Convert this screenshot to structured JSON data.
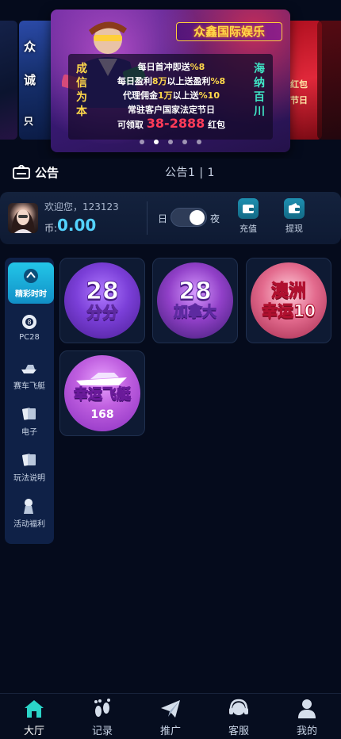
{
  "banner": {
    "brand": "众鑫国际娱乐",
    "left_side": "成信为本",
    "right_side": "海纳百川",
    "line1_pre": "每日首冲即送",
    "line1_hl": "%8",
    "line2_pre": "每日盈利",
    "line2_hl1": "8万",
    "line2_mid": "以上送盈利",
    "line2_hl2": "%8",
    "line3_pre": "代理佣金",
    "line3_hl1": "1万",
    "line3_mid": "以上送",
    "line3_hl2": "%10",
    "line4": "常驻客户国家法定节日",
    "line5_pre": "可领取",
    "line5_hl": "38-2888",
    "line5_post": "红包",
    "left_card_text1": "众",
    "left_card_text2": "诚",
    "left_card_text3": "只",
    "right_card_text1": "红包",
    "right_card_text2": "节日",
    "dots_count": 5,
    "active_dot": 1
  },
  "notice": {
    "title": "公告",
    "text": "公告1 | 1"
  },
  "user": {
    "welcome": "欢迎您，123123",
    "coin_label": "币:",
    "balance": "0.00",
    "day_label": "日",
    "night_label": "夜",
    "theme_mode": "night",
    "recharge_label": "充值",
    "withdraw_label": "提现"
  },
  "sidebar": {
    "items": [
      {
        "label": "精彩时时",
        "icon": "lottery-icon",
        "active": true
      },
      {
        "label": "PC28",
        "icon": "eight-ball-icon"
      },
      {
        "label": "赛车飞艇",
        "icon": "speedboat-icon"
      },
      {
        "label": "电子",
        "icon": "cards-icon"
      },
      {
        "label": "玩法说明",
        "icon": "cards-icon"
      },
      {
        "label": "活动福利",
        "icon": "gift-icon"
      }
    ]
  },
  "games": [
    {
      "main": "28",
      "sub": "分分"
    },
    {
      "main": "28",
      "sub": "加拿大"
    },
    {
      "main": "澳洲",
      "sub": "幸运10"
    },
    {
      "main": "幸运飞艇",
      "sub": "168"
    }
  ],
  "nav": {
    "items": [
      {
        "label": "大厅",
        "icon": "home-icon",
        "active": true
      },
      {
        "label": "记录",
        "icon": "footprints-icon"
      },
      {
        "label": "推广",
        "icon": "paper-plane-icon"
      },
      {
        "label": "客服",
        "icon": "headset-icon"
      },
      {
        "label": "我的",
        "icon": "user-icon"
      }
    ]
  },
  "colors": {
    "background": "#050b1c",
    "accent": "#54d3ff",
    "active_tab": "#23c6e8",
    "highlight_red": "#ff3b58",
    "gold": "#ffd84a"
  }
}
